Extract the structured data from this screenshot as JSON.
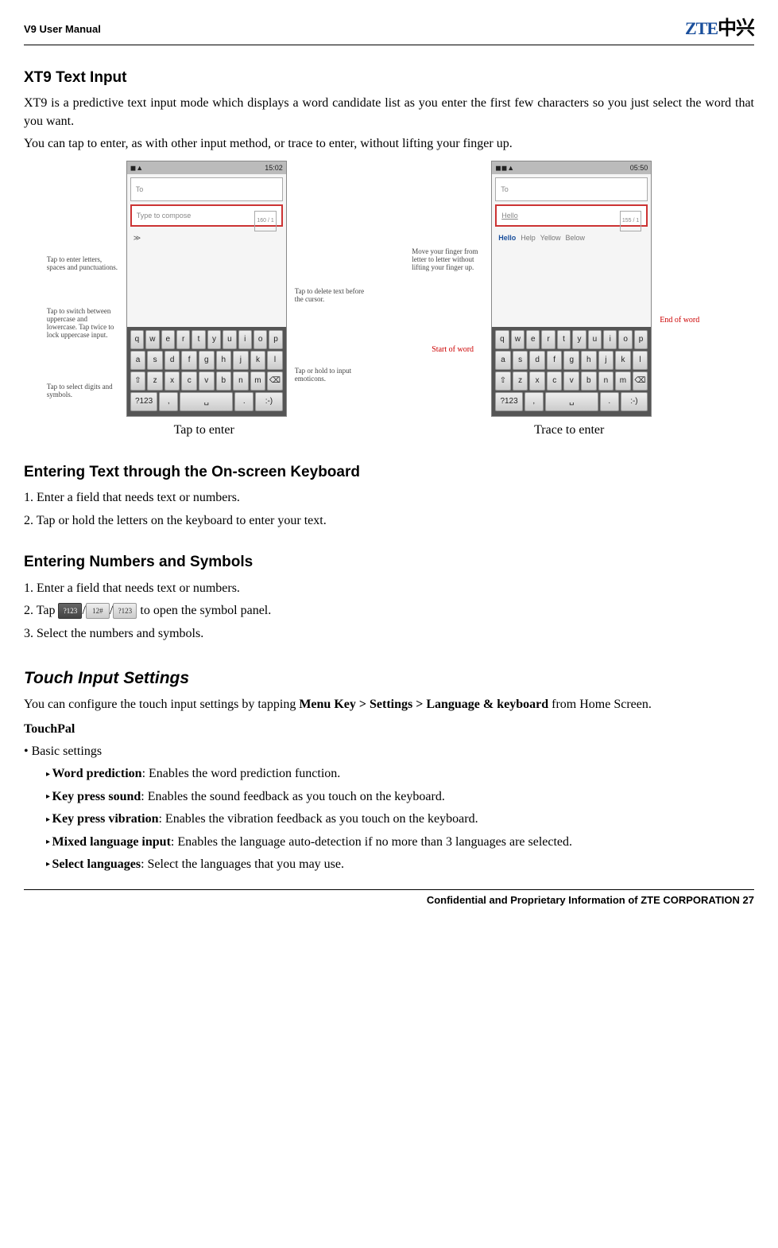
{
  "header": {
    "title": "V9 User Manual",
    "logo_en": "ZTE",
    "logo_cn": "中兴"
  },
  "s1": {
    "title": "XT9 Text Input",
    "p1": "XT9 is a predictive text input mode which displays a word candidate list as you enter the first few characters so you just select the word that you want.",
    "p2": "You can tap to enter, as with other input method, or trace to enter, without lifting your finger up."
  },
  "fig1": {
    "time": "15:02",
    "to": "To",
    "compose": "Type to compose",
    "counter": "160 / 1",
    "label_left1": "Tap to enter letters, spaces and punctuations.",
    "label_left2": "Tap to switch between uppercase and lowercase. Tap twice to lock uppercase input.",
    "label_left3": "Tap to select digits and symbols.",
    "label_right1": "Tap to delete text before the cursor.",
    "label_right2": "Tap or hold to input emoticons.",
    "caption": "Tap to enter"
  },
  "fig2": {
    "time": "05:50",
    "to": "To",
    "compose": "Hello",
    "counter": "155 / 1",
    "cands": [
      "Hello",
      "Help",
      "Yellow",
      "Below"
    ],
    "label_left": "Move your finger from letter to letter without lifting your finger up.",
    "label_start": "Start of word",
    "label_end": "End of word",
    "caption": "Trace to enter"
  },
  "s2": {
    "title": "Entering Text through the On-screen Keyboard",
    "p1": "1. Enter a field that needs text or numbers.",
    "p2": "2. Tap or hold the letters on the keyboard to enter your text."
  },
  "s3": {
    "title": "Entering Numbers and Symbols",
    "p1": "1. Enter a field that needs text or numbers.",
    "p2a": "2. Tap ",
    "p2b": " to open the symbol panel.",
    "icon1": "?123",
    "icon2": "12#",
    "icon3": "?123",
    "p3": "3. Select the numbers and symbols."
  },
  "s4": {
    "title": "Touch Input Settings",
    "p1a": "You can configure the touch input settings by tapping ",
    "p1b": "Menu Key > Settings > Language & keyboard",
    "p1c": " from Home Screen.",
    "sub": "TouchPal",
    "b1": "• Basic settings",
    "items": [
      {
        "t": "Word prediction",
        "d": ": Enables the word prediction function."
      },
      {
        "t": "Key press sound",
        "d": ": Enables the sound feedback as you touch on the keyboard."
      },
      {
        "t": "Key press vibration",
        "d": ": Enables the vibration feedback as you touch on the keyboard."
      },
      {
        "t": "Mixed language input",
        "d": ": Enables the language auto-detection if no more than 3 languages are selected."
      },
      {
        "t": "Select languages",
        "d": ": Select the languages that you may use."
      }
    ]
  },
  "footer": {
    "text": "Confidential and Proprietary Information of ZTE CORPORATION 27"
  }
}
